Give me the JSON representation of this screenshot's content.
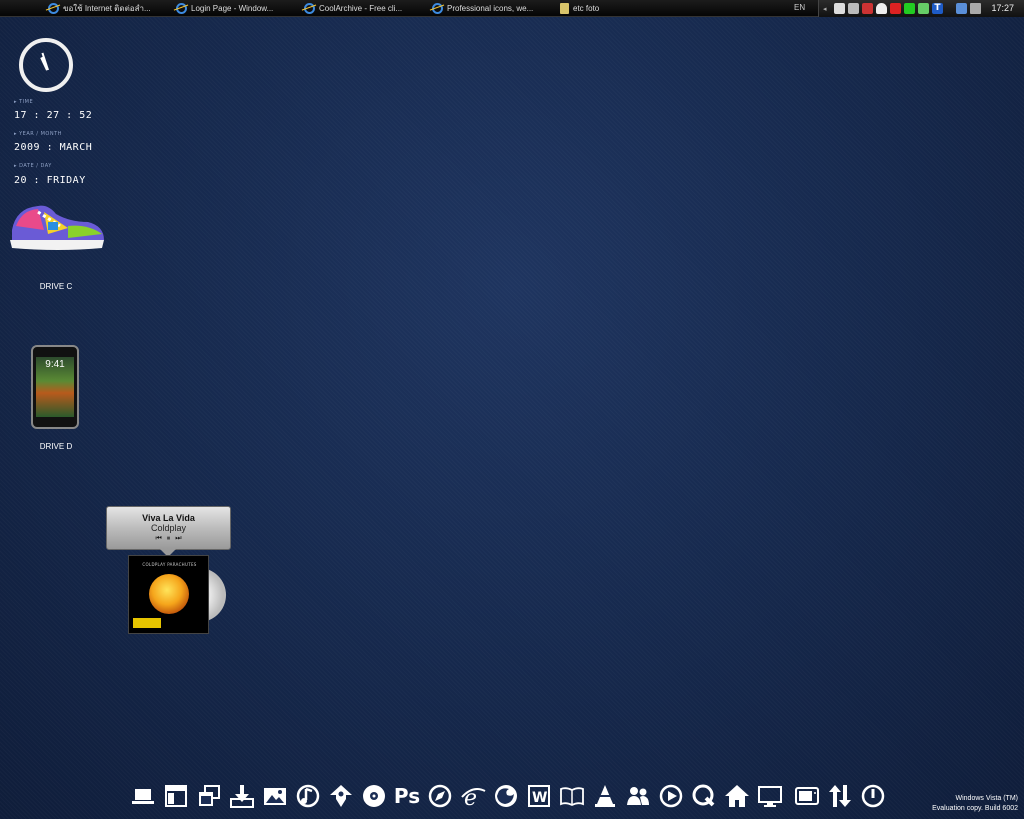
{
  "taskbar": {
    "tasks": [
      {
        "label": "ขอใช้ Internet ติดต่อสำ...",
        "icon": "ie-icon"
      },
      {
        "label": "Login Page - Window...",
        "icon": "ie-icon"
      },
      {
        "label": "CoolArchive - Free cli...",
        "icon": "ie-icon"
      },
      {
        "label": "Professional icons, we...",
        "icon": "ie-icon"
      },
      {
        "label": "etc foto",
        "icon": "folder-icon"
      }
    ],
    "language": "EN",
    "clock": "17:27",
    "tray_icons": [
      "shield-icon",
      "network-icon",
      "antivirus-icon",
      "flame-icon",
      "no-entry-icon",
      "flag-icon",
      "pencil-icon",
      "t-icon",
      "monitor-icon",
      "volume-icon"
    ]
  },
  "clock_widget": {
    "time_label": "TIME",
    "time": "17 : 27 : 52",
    "year_label": "YEAR / MONTH",
    "year_month": "2009 : MARCH",
    "date_label": "DATE / DAY",
    "date_day": "20 : FRIDAY"
  },
  "desktop_icons": [
    {
      "label": "DRIVE C",
      "icon": "sneaker-icon"
    },
    {
      "label": "DRIVE D",
      "icon": "iphone-icon"
    }
  ],
  "phone_time": "9:41",
  "now_playing": {
    "title": "Viva La Vida",
    "artist": "Coldplay",
    "album_caption": "COLDPLAY PARACHUTES",
    "controls": [
      "⏮",
      "⏸",
      "⏭"
    ]
  },
  "dock": [
    "laptop-icon",
    "window-icon",
    "windows-stack-icon",
    "download-icon",
    "picture-icon",
    "music-note-icon",
    "inkscape-icon",
    "cd-icon",
    "photoshop-icon",
    "compass-icon",
    "internet-explorer-icon",
    "firefox-icon",
    "word-icon",
    "book-icon",
    "vlc-icon",
    "users-icon",
    "play-icon",
    "quicktime-icon",
    "home-icon",
    "monitor-icon",
    "tv-icon",
    "transfer-icon",
    "power-icon"
  ],
  "photoshop_label": "Ps",
  "word_label": "W",
  "os_watermark": {
    "line1": "Windows Vista (TM)",
    "line2": "Evaluation copy. Build 6002"
  }
}
